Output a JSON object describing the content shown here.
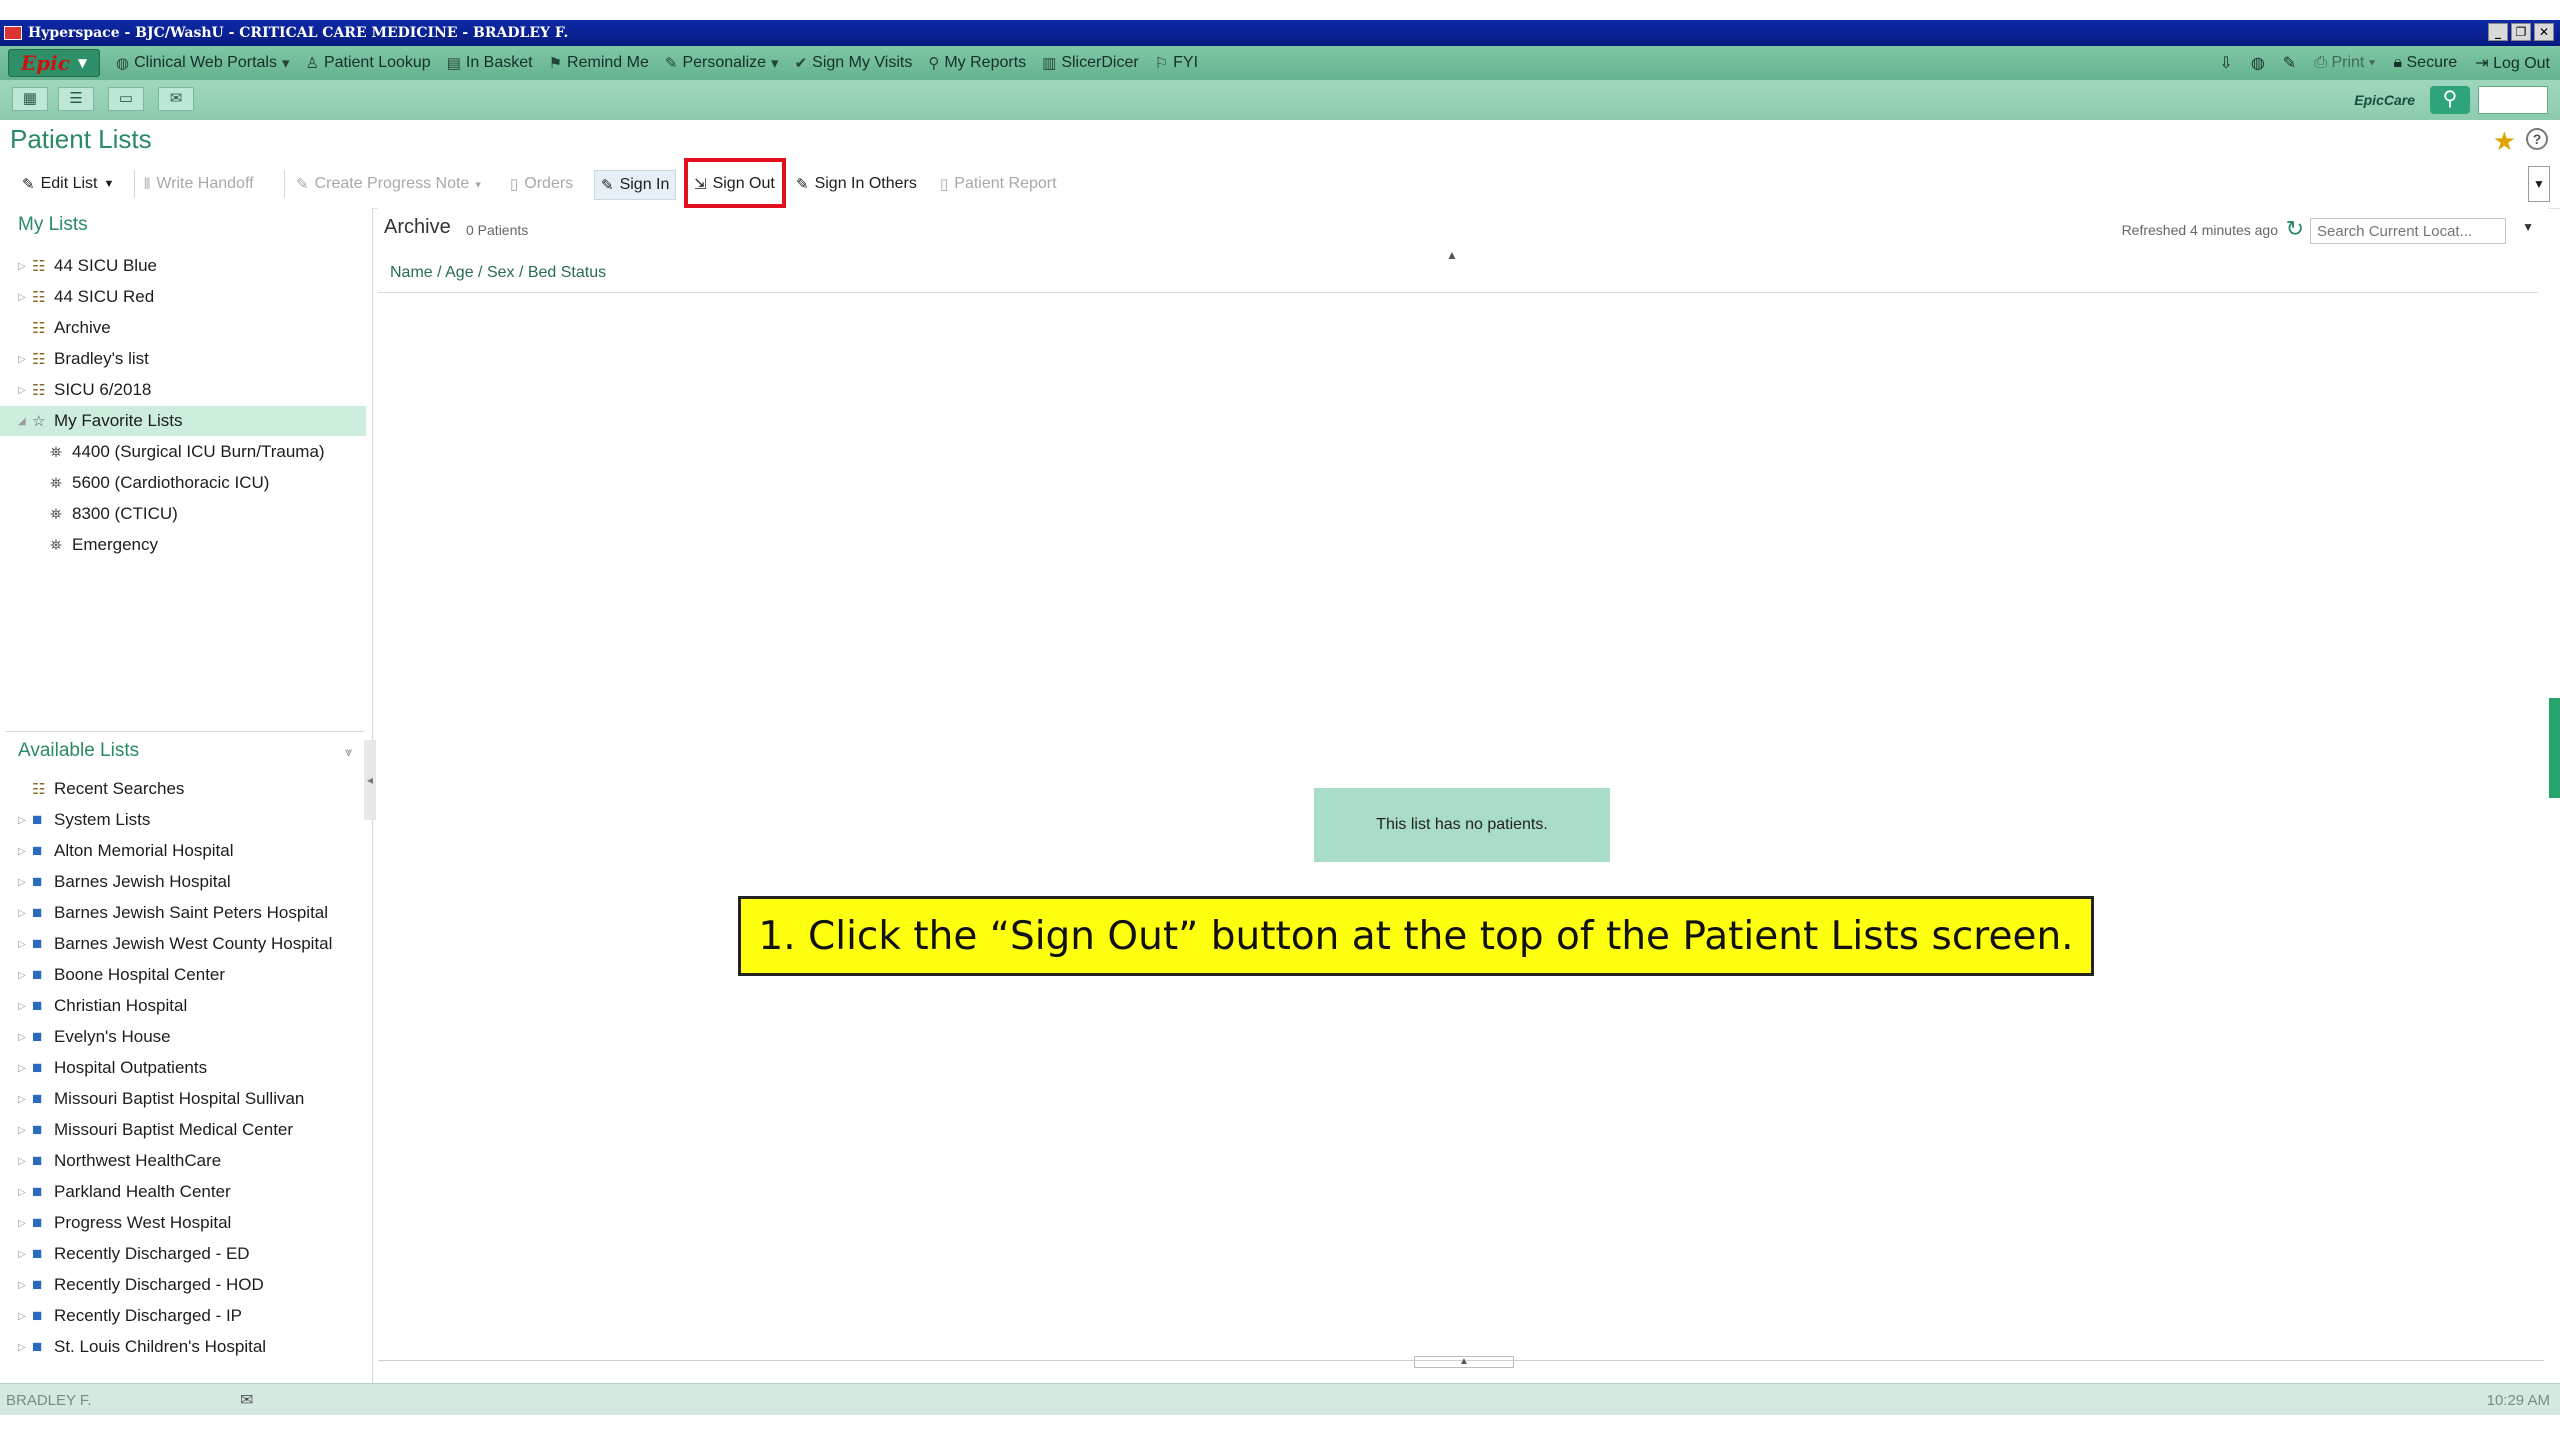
{
  "window": {
    "title": "Hyperspace - BJC/WashU - CRITICAL CARE MEDICINE - BRADLEY F.",
    "controls": [
      "_",
      "❐",
      "✕"
    ]
  },
  "epicbar": {
    "epic_label": "Epic",
    "items": [
      {
        "label": "Clinical Web Portals",
        "icon": "globe-icon"
      },
      {
        "label": "Patient Lookup",
        "icon": "person-icon"
      },
      {
        "label": "In Basket",
        "icon": "inbox-icon"
      },
      {
        "label": "Remind Me",
        "icon": "flag-icon"
      },
      {
        "label": "Personalize",
        "icon": "wrench-icon"
      },
      {
        "label": "Sign My Visits",
        "icon": "checkmark-icon"
      },
      {
        "label": "My Reports",
        "icon": "search-icon"
      },
      {
        "label": "SlicerDicer",
        "icon": "chart-icon"
      },
      {
        "label": "FYI",
        "icon": "flag-icon"
      }
    ],
    "right": {
      "print": "Print",
      "secure": "Secure",
      "logout": "Log Out"
    }
  },
  "row2": {
    "epiccare": "EpicCare"
  },
  "page": {
    "title": "Patient Lists"
  },
  "actions": {
    "edit_list": "Edit List",
    "write_handoff": "Write Handoff",
    "create_progress_note": "Create Progress Note",
    "orders": "Orders",
    "sign_in": "Sign In",
    "sign_out": "Sign Out",
    "sign_in_others": "Sign In Others",
    "patient_report": "Patient Report"
  },
  "left": {
    "my_lists_title": "My Lists",
    "my_lists": [
      "44 SICU Blue",
      "44 SICU Red",
      "Archive",
      "Bradley's list",
      "SICU 6/2018"
    ],
    "favorites_label": "My Favorite Lists",
    "favorites": [
      "4400 (Surgical ICU Burn/Trauma)",
      "5600 (Cardiothoracic ICU)",
      "8300 (CTICU)",
      "Emergency"
    ],
    "available_title": "Available Lists",
    "available": [
      "Recent Searches",
      "System Lists",
      "Alton Memorial Hospital",
      "Barnes Jewish Hospital",
      "Barnes Jewish Saint Peters Hospital",
      "Barnes Jewish West County Hospital",
      "Boone Hospital Center",
      "Christian Hospital",
      "Evelyn's House",
      "Hospital Outpatients",
      "Missouri Baptist Hospital Sullivan",
      "Missouri Baptist Medical Center",
      "Northwest HealthCare",
      "Parkland Health Center",
      "Progress West Hospital",
      "Recently Discharged - ED",
      "Recently Discharged - HOD",
      "Recently Discharged - IP",
      "St. Louis Children's Hospital"
    ]
  },
  "main": {
    "list_name": "Archive",
    "patient_count": "0 Patients",
    "refreshed": "Refreshed 4 minutes ago",
    "search_placeholder": "Search Current Locat...",
    "column_header": "Name / Age / Sex / Bed Status",
    "empty_message": "This list has no patients."
  },
  "callout": {
    "text": "1. Click the “Sign Out” button at the top of the Patient Lists screen."
  },
  "status": {
    "user": "BRADLEY F.",
    "time": "10:29 AM"
  },
  "colors": {
    "accent": "#2a8a63",
    "highlight_frame": "#e0101c",
    "callout": "#ffff10"
  }
}
